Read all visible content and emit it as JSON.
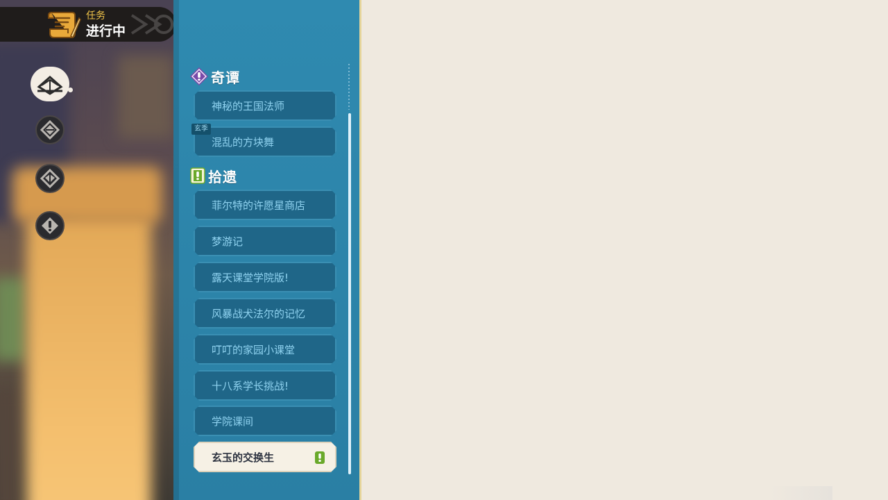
{
  "header": {
    "subtitle": "任务",
    "title": "进行中"
  },
  "rail": {
    "items": [
      "quest-book-icon",
      "compass-diamond-icon",
      "gem-diamond-icon",
      "exclamation-icon"
    ]
  },
  "categories": [
    {
      "label": "奇谭",
      "icon": "purple-exclamation-icon",
      "color": "#7a4aa8",
      "quests": [
        {
          "label": "神秘的王国法师"
        },
        {
          "label": "混乱的方块舞",
          "tag": "玄季"
        }
      ]
    },
    {
      "label": "拾遗",
      "icon": "green-exclamation-icon",
      "color": "#6aa92a",
      "quests": [
        {
          "label": "菲尔特的许愿星商店"
        },
        {
          "label": "梦游记"
        },
        {
          "label": "露天课堂学院版!"
        },
        {
          "label": "风暴战犬法尔的记忆"
        },
        {
          "label": "叮叮的家园小课堂"
        },
        {
          "label": "十八系学长挑战!"
        },
        {
          "label": "学院课间"
        },
        {
          "label": "玄玉的交换生",
          "selected": true
        }
      ]
    }
  ]
}
